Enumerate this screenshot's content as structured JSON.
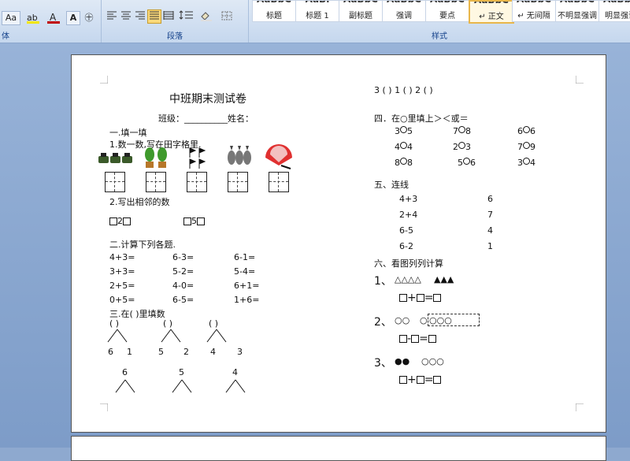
{
  "ribbon": {
    "font_group_label": "体",
    "para_group_label": "段落",
    "styles_group_label": "样式",
    "font_size_btn": "Aa",
    "styles": [
      {
        "preview": "AaBbC",
        "label": "标题"
      },
      {
        "preview": "AaBl",
        "label": "标题 1"
      },
      {
        "preview": "AaBbC",
        "label": "副标题"
      },
      {
        "preview": "AaBbC",
        "label": "强调"
      },
      {
        "preview": "AaBbC",
        "label": "要点"
      },
      {
        "preview": "AaBbC",
        "label": "↵ 正文"
      },
      {
        "preview": "AaBbC",
        "label": "↵ 无间隔"
      },
      {
        "preview": "AaBbC",
        "label": "不明显强调"
      },
      {
        "preview": "AaBbC",
        "label": "明显强调"
      }
    ],
    "colors": {
      "highlight": "#f2e600",
      "font_color": "#c00000",
      "active_style_border": "#e8b64a"
    }
  },
  "doc": {
    "title": "中班期末测试卷",
    "class_name_line": "班级：__________姓名：",
    "s1_heading": "一.填一填",
    "s1_q1": "1.数一数,写在田字格里.",
    "s1_q2": "2.写出相邻的数",
    "s1_adj1_mid": "2",
    "s1_adj2_mid": "5",
    "s2_heading": "二.计算下列各题.",
    "s2_rows": [
      [
        "4+3=",
        "6-3=",
        "6-1="
      ],
      [
        "3+3=",
        "5-2=",
        "5-4="
      ],
      [
        "2+5=",
        "4-0=",
        "6+1="
      ],
      [
        "0+5=",
        "6-5=",
        "1+6="
      ]
    ],
    "s3_heading": "三.在(    )里填数",
    "s3_tree1": "( )",
    "s3_tree2": "( )",
    "s3_tree3": "( )",
    "s3_bottoms": [
      [
        "6",
        "1"
      ],
      [
        "5",
        "2"
      ],
      [
        "4",
        "3"
      ]
    ],
    "s3_tops": [
      "6",
      "5",
      "4"
    ],
    "r_top_line": "3  (  )  1   (  )  2  (  )",
    "s4_heading": "四．在○里填上＞＜或＝",
    "s4_rows": [
      [
        [
          "3",
          "5"
        ],
        [
          "7",
          "8"
        ],
        [
          "6",
          "6"
        ]
      ],
      [
        [
          "4",
          "4"
        ],
        [
          "2",
          "3"
        ],
        [
          "7",
          "9"
        ]
      ],
      [
        [
          "8",
          "8"
        ],
        [
          "5",
          "6"
        ],
        [
          "3",
          "4"
        ]
      ]
    ],
    "s5_heading": "五、连线",
    "s5_left": [
      "4+3",
      "2+4",
      "6-5",
      "6-2"
    ],
    "s5_right": [
      "6",
      "7",
      "4",
      "1"
    ],
    "s6_heading": "六、看图列列计算",
    "s6_1_num": "1、",
    "s6_1_shapes_a": "△△△△",
    "s6_1_shapes_b": "▲▲▲",
    "s6_1_op": "+",
    "s6_2_num": "2、",
    "s6_2_shapes_a": "○○",
    "s6_2_shapes_b": "○",
    "s6_2_shapes_c": "○○○",
    "s6_2_op": "-",
    "s6_3_num": "3、",
    "s6_3_shapes_a": "●●",
    "s6_3_shapes_b": "○○○",
    "s6_3_op": "+",
    "eq": "="
  }
}
